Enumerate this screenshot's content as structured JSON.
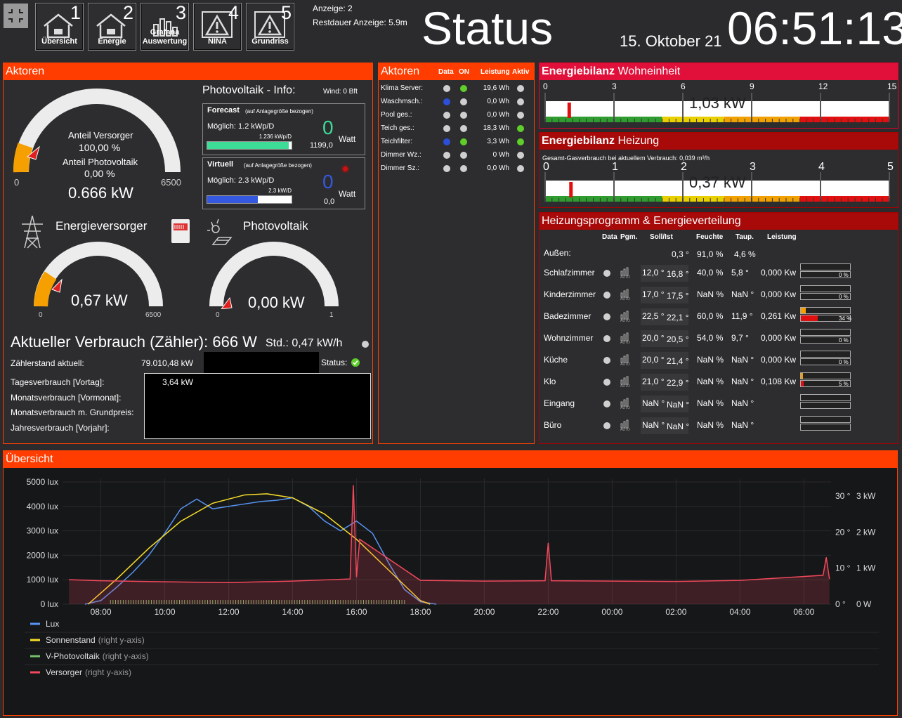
{
  "nav": [
    {
      "num": "1",
      "label": "Übersicht",
      "icon": "house-icon"
    },
    {
      "num": "2",
      "label": "Energie",
      "icon": "house-icon"
    },
    {
      "num": "3",
      "label": "Grafana Auswertung",
      "icon": "bar-chart-icon"
    },
    {
      "num": "4",
      "label": "NINA",
      "icon": "warning-icon"
    },
    {
      "num": "5",
      "label": "Grundriss",
      "icon": "warning-icon"
    }
  ],
  "header": {
    "anzeige": "Anzeige: 2",
    "restdauer": "Restdauer Anzeige: 5.9m",
    "title": "Status",
    "date": "15. Oktober 21",
    "time": "06:51:13"
  },
  "aktoren_left": {
    "title": "Aktoren",
    "gauge_main": {
      "label_versorger": "Anteil Versorger",
      "versorger_pct": "100,00 %",
      "label_pv": "Anteil Photovoltaik",
      "pv_pct": "0,00 %",
      "value": "0.666 kW",
      "min": "0",
      "max": "6500"
    },
    "pv_info": {
      "title": "Photovoltaik - Info:",
      "wind": "Wind: 0 Bft"
    },
    "forecast": {
      "title": "Forecast",
      "note": "(auf Anlagegröße bezogen)",
      "possible": "Möglich: 1.2 kWp/D",
      "kwp": "1.236 kWp/D",
      "value": "0",
      "value2": "1199,0",
      "unit": "Watt",
      "fill": 0.97
    },
    "virtuell": {
      "title": "Virtuell",
      "note": "(auf Anlagegröße bezogen)",
      "possible": "Möglich: 2.3 kWp/D",
      "kwp": "2.3 kW/D",
      "value": "0",
      "value2": "0,0",
      "unit": "Watt",
      "fill": 0.6
    },
    "energieversorger": {
      "title": "Energieversorger",
      "value": "0,67 kW",
      "min": "0",
      "max": "6500"
    },
    "photovoltaik": {
      "title": "Photovoltaik",
      "value": "0,00 kW",
      "min": "0",
      "max": "1"
    },
    "verbrauch": {
      "title": "Aktueller Verbrauch (Zähler): 666 W",
      "std": "Std.: 0,47 kW/h",
      "status": "Status:"
    },
    "rows": [
      {
        "label": "Zählerstand aktuell:",
        "value": "79.010,48 kW"
      },
      {
        "label": "Tagesverbrauch [Vortag]:",
        "value": "3,64 kW"
      },
      {
        "label": "Monatsverbrauch [Vormonat]:",
        "value": ""
      },
      {
        "label": "Monatsverbrauch m. Grundpreis:",
        "value": ""
      },
      {
        "label": "Jahresverbrauch [Vorjahr]:",
        "value": ""
      }
    ]
  },
  "aktoren_mid": {
    "title": "Aktoren",
    "cols": {
      "data": "Data",
      "on": "ON",
      "leistung": "Leistung",
      "aktiv": "Aktiv"
    },
    "rows": [
      {
        "name": "Klima Server:",
        "data": "gray",
        "on": "green",
        "leistung": "19,6 Wh",
        "aktiv": "gray"
      },
      {
        "name": "Waschmsch.:",
        "data": "blue",
        "on": "gray",
        "leistung": "0,0 Wh",
        "aktiv": "gray"
      },
      {
        "name": "Pool ges.:",
        "data": "gray",
        "on": "gray",
        "leistung": "0,0 Wh",
        "aktiv": "gray"
      },
      {
        "name": "Teich ges.:",
        "data": "gray",
        "on": "gray",
        "leistung": "18,3 Wh",
        "aktiv": "green"
      },
      {
        "name": "Teichfilter:",
        "data": "blue",
        "on": "green",
        "leistung": "3,3 Wh",
        "aktiv": "green"
      },
      {
        "name": "Dimmer Wz.:",
        "data": "gray",
        "on": "gray",
        "leistung": "0 Wh",
        "aktiv": "gray"
      },
      {
        "name": "Dimmer Sz.:",
        "data": "gray",
        "on": "gray",
        "leistung": "0,0 Wh",
        "aktiv": "gray"
      }
    ]
  },
  "energiebilanz_wohn": {
    "title_bold": "Energiebilanz",
    "title": "Wohneinheit",
    "value": "1,03 kW",
    "ticks": [
      "0",
      "3",
      "6",
      "9",
      "12",
      "15"
    ],
    "level": 0.069
  },
  "energiebilanz_heiz": {
    "title_bold": "Energiebilanz",
    "title": "Heizung",
    "note": "Gesamt-Gasverbrauch bei aktuellem Verbrauch: 0,039 m³/h",
    "value": "0,37 kW",
    "ticks": [
      "0",
      "1",
      "2",
      "3",
      "4",
      "5"
    ],
    "level": 0.074
  },
  "heizung": {
    "title": "Heizungsprogramm & Energieverteilung",
    "cols": {
      "data": "Data",
      "pgm": "Pgm.",
      "soll": "Soll/Ist",
      "feuchte": "Feuchte",
      "taup": "Taup.",
      "leistung": "Leistung"
    },
    "aussen": {
      "name": "Außen:",
      "ist": "0,3 °",
      "feuchte": "91,0 %",
      "taup": "4,6 %"
    },
    "rooms": [
      {
        "name": "Schlafzimmer",
        "soll": "12,0 °",
        "ist": "16,8 °",
        "feuchte": "40,0 %",
        "taup": "5,8 °",
        "leistung": "0,000 Kw",
        "pct": "0 %",
        "p1": 0,
        "p2": 0
      },
      {
        "name": "Kinderzimmer",
        "soll": "17,0 °",
        "ist": "17,5 °",
        "feuchte": "NaN %",
        "taup": "NaN °",
        "leistung": "0,000 Kw",
        "pct": "0 %",
        "p1": 0,
        "p2": 0
      },
      {
        "name": "Badezimmer",
        "soll": "22,5 °",
        "ist": "22,1 °",
        "feuchte": "60,0 %",
        "taup": "11,9 °",
        "leistung": "0,261 Kw",
        "pct": "34 %",
        "p1": 0.1,
        "p2": 0.34
      },
      {
        "name": "Wohnzimmer",
        "soll": "20,0 °",
        "ist": "20,5 °",
        "feuchte": "54,0 %",
        "taup": "9,7 °",
        "leistung": "0,000 Kw",
        "pct": "0 %",
        "p1": 0,
        "p2": 0
      },
      {
        "name": "Küche",
        "soll": "20,0 °",
        "ist": "21,4 °",
        "feuchte": "NaN %",
        "taup": "NaN °",
        "leistung": "0,000 Kw",
        "pct": "0 %",
        "p1": 0,
        "p2": 0
      },
      {
        "name": "Klo",
        "soll": "21,0 °",
        "ist": "22,9 °",
        "feuchte": "NaN %",
        "taup": "NaN °",
        "leistung": "0,108 Kw",
        "pct": "5 %",
        "p1": 0.04,
        "p2": 0.05
      },
      {
        "name": "Eingang",
        "soll": "NaN °",
        "ist": "NaN °",
        "feuchte": "NaN %",
        "taup": "NaN °",
        "leistung": "",
        "pct": "",
        "p1": 0,
        "p2": 0
      },
      {
        "name": "Büro",
        "soll": "NaN °",
        "ist": "NaN °",
        "feuchte": "NaN %",
        "taup": "NaN °",
        "leistung": "",
        "pct": "",
        "p1": 0,
        "p2": 0
      }
    ]
  },
  "overview": {
    "title": "Übersicht"
  },
  "chart_data": {
    "type": "line",
    "x_ticks": [
      "08:00",
      "10:00",
      "12:00",
      "14:00",
      "16:00",
      "18:00",
      "20:00",
      "22:00",
      "00:00",
      "02:00",
      "04:00",
      "06:00"
    ],
    "y_left_ticks": [
      "0 lux",
      "1000 lux",
      "2000 lux",
      "3000 lux",
      "4000 lux",
      "5000 lux"
    ],
    "y_right_deg_ticks": [
      "0 °",
      "10 °",
      "20 °",
      "30 °"
    ],
    "y_right_kw_ticks": [
      "0 W",
      "1 kW",
      "2 kW",
      "3 kW"
    ],
    "series": [
      {
        "name": "Lux",
        "suffix": "",
        "color": "#5794f2",
        "x": [
          7.5,
          8.0,
          8.5,
          9.0,
          9.5,
          10.0,
          10.5,
          11.0,
          11.5,
          12.0,
          12.5,
          13.0,
          13.5,
          14.0,
          14.5,
          15.0,
          15.5,
          16.0,
          16.5,
          17.0,
          17.5,
          18.0,
          18.5
        ],
        "values": [
          0,
          150,
          700,
          1300,
          2000,
          2900,
          3900,
          4300,
          3900,
          4000,
          4100,
          4200,
          4250,
          4350,
          4000,
          3400,
          3000,
          3400,
          2900,
          1700,
          600,
          100,
          0
        ]
      },
      {
        "name": "Sonnenstand",
        "suffix": "(right y-axis)",
        "color": "#fade2a",
        "x": [
          7.6,
          8.5,
          9.5,
          10.5,
          11.5,
          12.5,
          13.2,
          14.0,
          15.0,
          16.0,
          17.0,
          18.0,
          18.3
        ],
        "values": [
          0,
          7,
          15.5,
          23,
          28,
          30.3,
          30.6,
          29.5,
          25,
          18,
          9.5,
          1,
          0
        ]
      },
      {
        "name": "V-Photovoltaik",
        "suffix": "(right y-axis)",
        "color": "#73bf69",
        "x": [
          8.0,
          10.0,
          12.0,
          14.0,
          16.0,
          17.5
        ],
        "values": [
          0,
          0.1,
          0.12,
          0.15,
          0.1,
          0
        ]
      },
      {
        "name": "Versorger",
        "suffix": "(right y-axis)",
        "color": "#f2495c",
        "x": [
          7.0,
          8.0,
          10.0,
          12.0,
          14.0,
          15.8,
          15.9,
          16.0,
          16.1,
          18.0,
          20.0,
          21.9,
          22.0,
          22.1,
          24.0,
          26.0,
          28.0,
          30.6,
          30.7,
          30.8
        ],
        "values": [
          0.68,
          0.65,
          0.62,
          0.6,
          0.64,
          0.7,
          3.3,
          0.75,
          1.8,
          0.66,
          0.64,
          0.65,
          1.7,
          0.65,
          0.64,
          0.63,
          0.66,
          0.8,
          1.3,
          0.7
        ]
      }
    ]
  }
}
